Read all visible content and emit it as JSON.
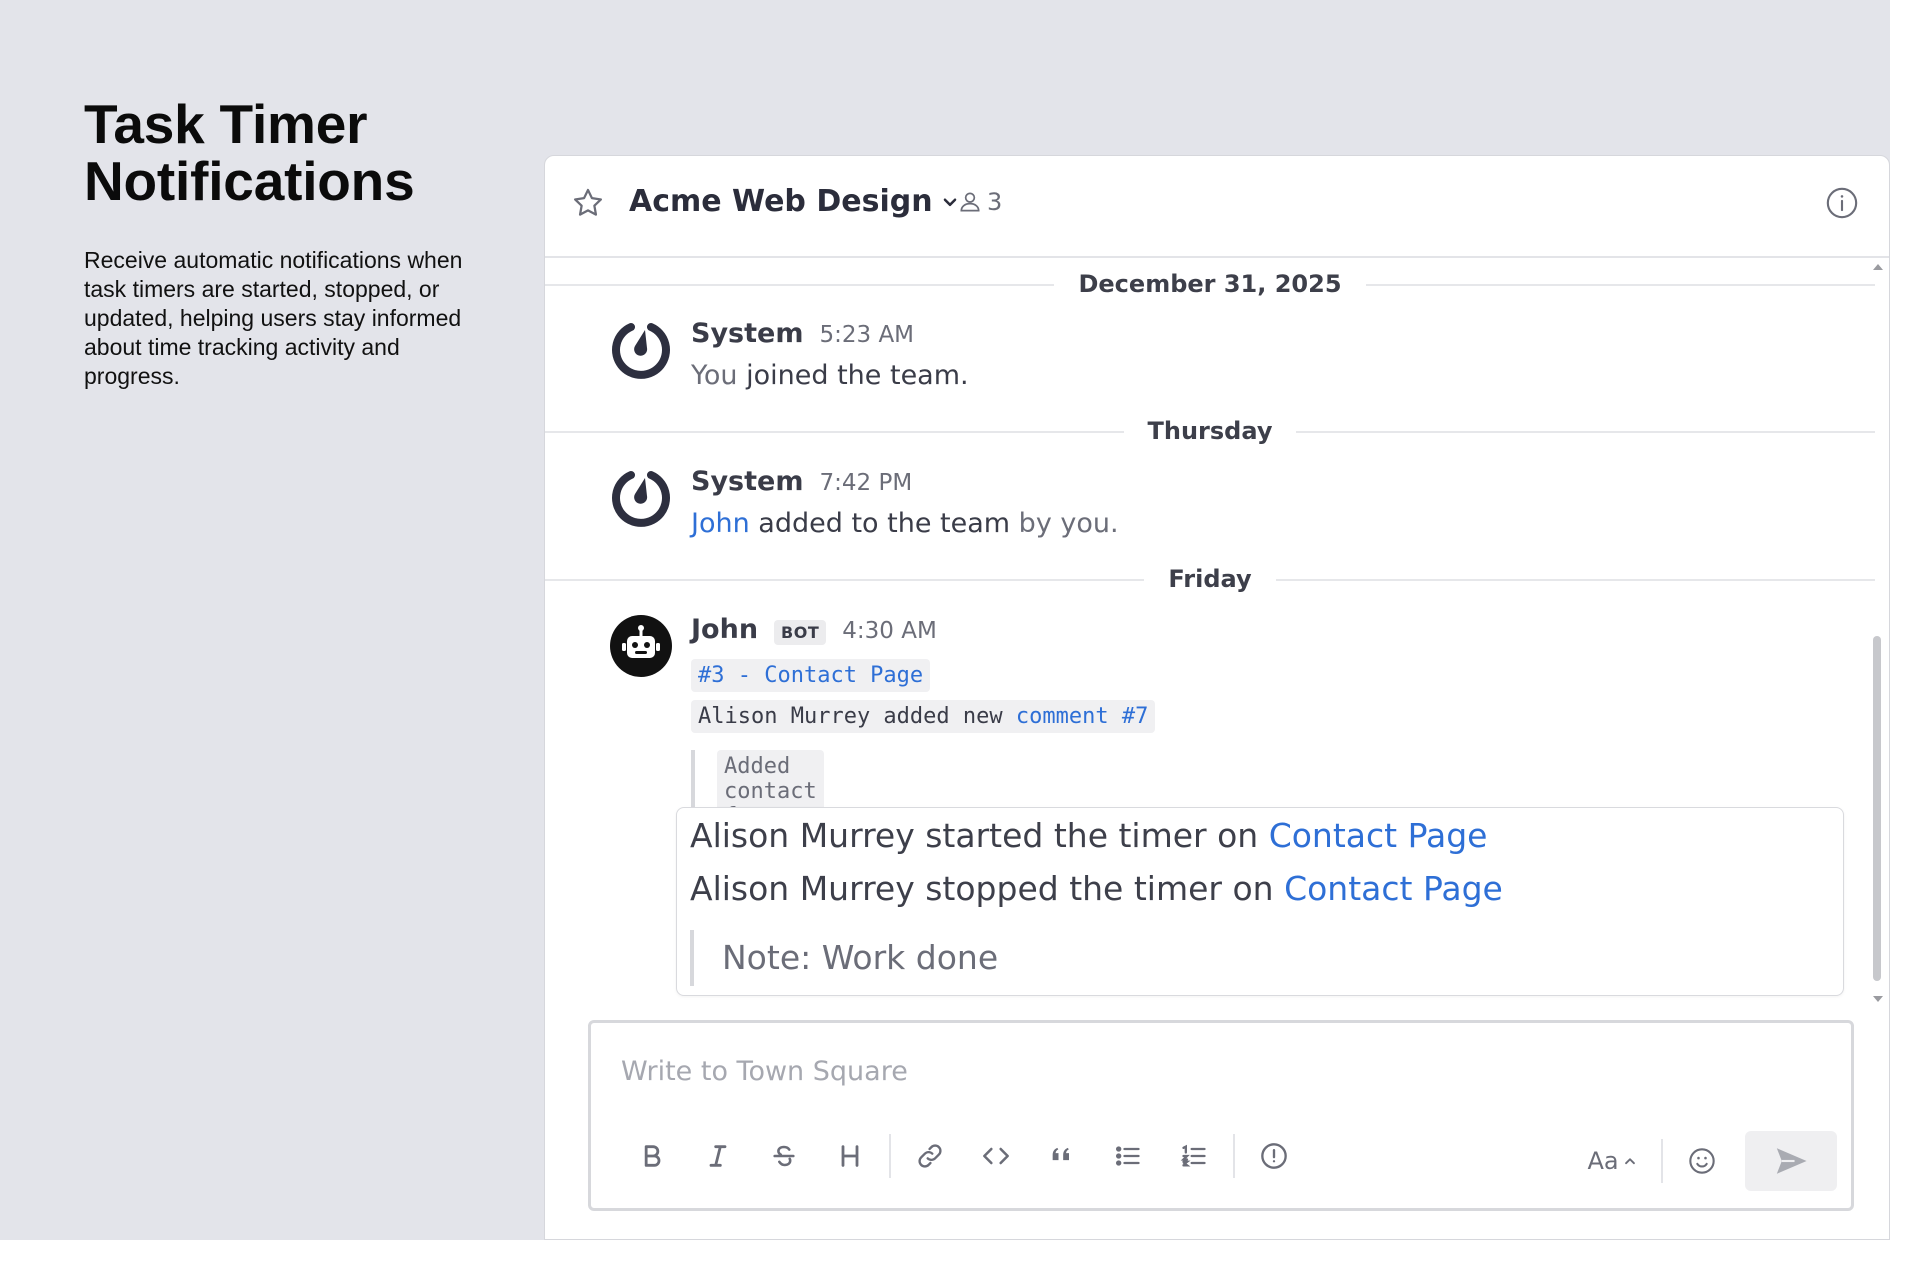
{
  "promo": {
    "title": "Task Timer Notifications",
    "description": "Receive automatic notifications when task timers are started, stopped, or updated, helping users stay informed about time tracking activity and progress."
  },
  "header": {
    "channel_name": "Acme Web Design",
    "member_count": "3"
  },
  "date_separators": [
    "December 31, 2025",
    "Thursday",
    "Friday"
  ],
  "posts": [
    {
      "author": "System",
      "time": "5:23 AM",
      "body_prefix": "You",
      "body_strong": " joined the team."
    },
    {
      "author": "System",
      "time": "7:42 PM",
      "mention": "John",
      "body_strong": " added to the team",
      "body_suffix": " by you."
    },
    {
      "author": "John",
      "badge": "BOT",
      "time": "4:30 AM",
      "task_link": "#3 - Contact Page",
      "comment_prefix": "Alison Murrey added new",
      "comment_link": "comment #7",
      "quote": "Added contact form..."
    }
  ],
  "attachment": {
    "line1_text": "Alison Murrey started the timer on ",
    "line1_link": "Contact Page",
    "line2_text": "Alison Murrey stopped the timer on ",
    "line2_link": "Contact Page",
    "note": "Note: Work done"
  },
  "composer": {
    "placeholder": "Write to Town Square",
    "format_label": "Aa"
  },
  "colors": {
    "link": "#2e6fd6",
    "background": "#e3e4ea"
  }
}
